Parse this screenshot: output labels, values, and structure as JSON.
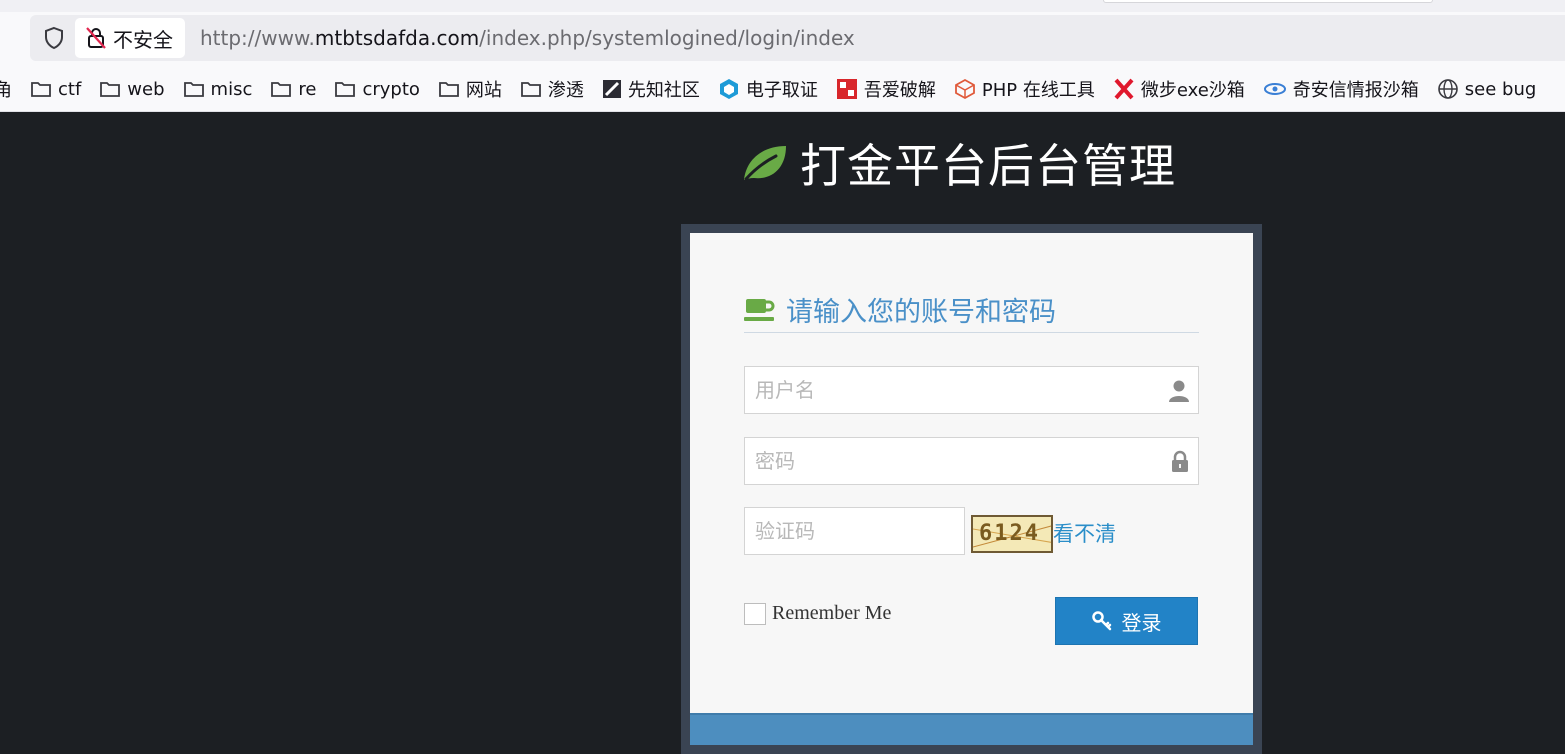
{
  "browser": {
    "security_label": "不安全",
    "url_prefix": "http://www.",
    "url_host": "mtbtsdafda.com",
    "url_path": "/index.php/systemlogined/login/index"
  },
  "bookmarks": [
    {
      "label": "角",
      "icon": "none"
    },
    {
      "label": "ctf",
      "icon": "folder-icon"
    },
    {
      "label": "web",
      "icon": "folder-icon"
    },
    {
      "label": "misc",
      "icon": "folder-icon"
    },
    {
      "label": "re",
      "icon": "folder-icon"
    },
    {
      "label": "crypto",
      "icon": "folder-icon"
    },
    {
      "label": "网站",
      "icon": "folder-icon"
    },
    {
      "label": "渗透",
      "icon": "folder-icon"
    },
    {
      "label": "先知社区",
      "icon": "xianzhi-icon"
    },
    {
      "label": "电子取证",
      "icon": "cube-icon"
    },
    {
      "label": "吾爱破解",
      "icon": "52pojie-icon"
    },
    {
      "label": "PHP 在线工具",
      "icon": "php-tool-icon"
    },
    {
      "label": "微步exe沙箱",
      "icon": "threatbook-icon"
    },
    {
      "label": "奇安信情报沙箱",
      "icon": "qianxin-icon"
    },
    {
      "label": "see bug",
      "icon": "globe-icon"
    }
  ],
  "page": {
    "brand_title": "打金平台后台管理",
    "form_heading": "请输入您的账号和密码",
    "username_placeholder": "用户名",
    "password_placeholder": "密码",
    "captcha_placeholder": "验证码",
    "captcha_text": "6124",
    "captcha_refresh": "看不清",
    "remember_label": "Remember Me",
    "login_label": "登录"
  },
  "colors": {
    "page_bg": "#1c1f23",
    "frame": "#3a4453",
    "accent_green": "#69aa46",
    "heading_blue": "#4a90c8",
    "button_blue": "#2283c7",
    "footer_blue": "#4d8ebf"
  }
}
